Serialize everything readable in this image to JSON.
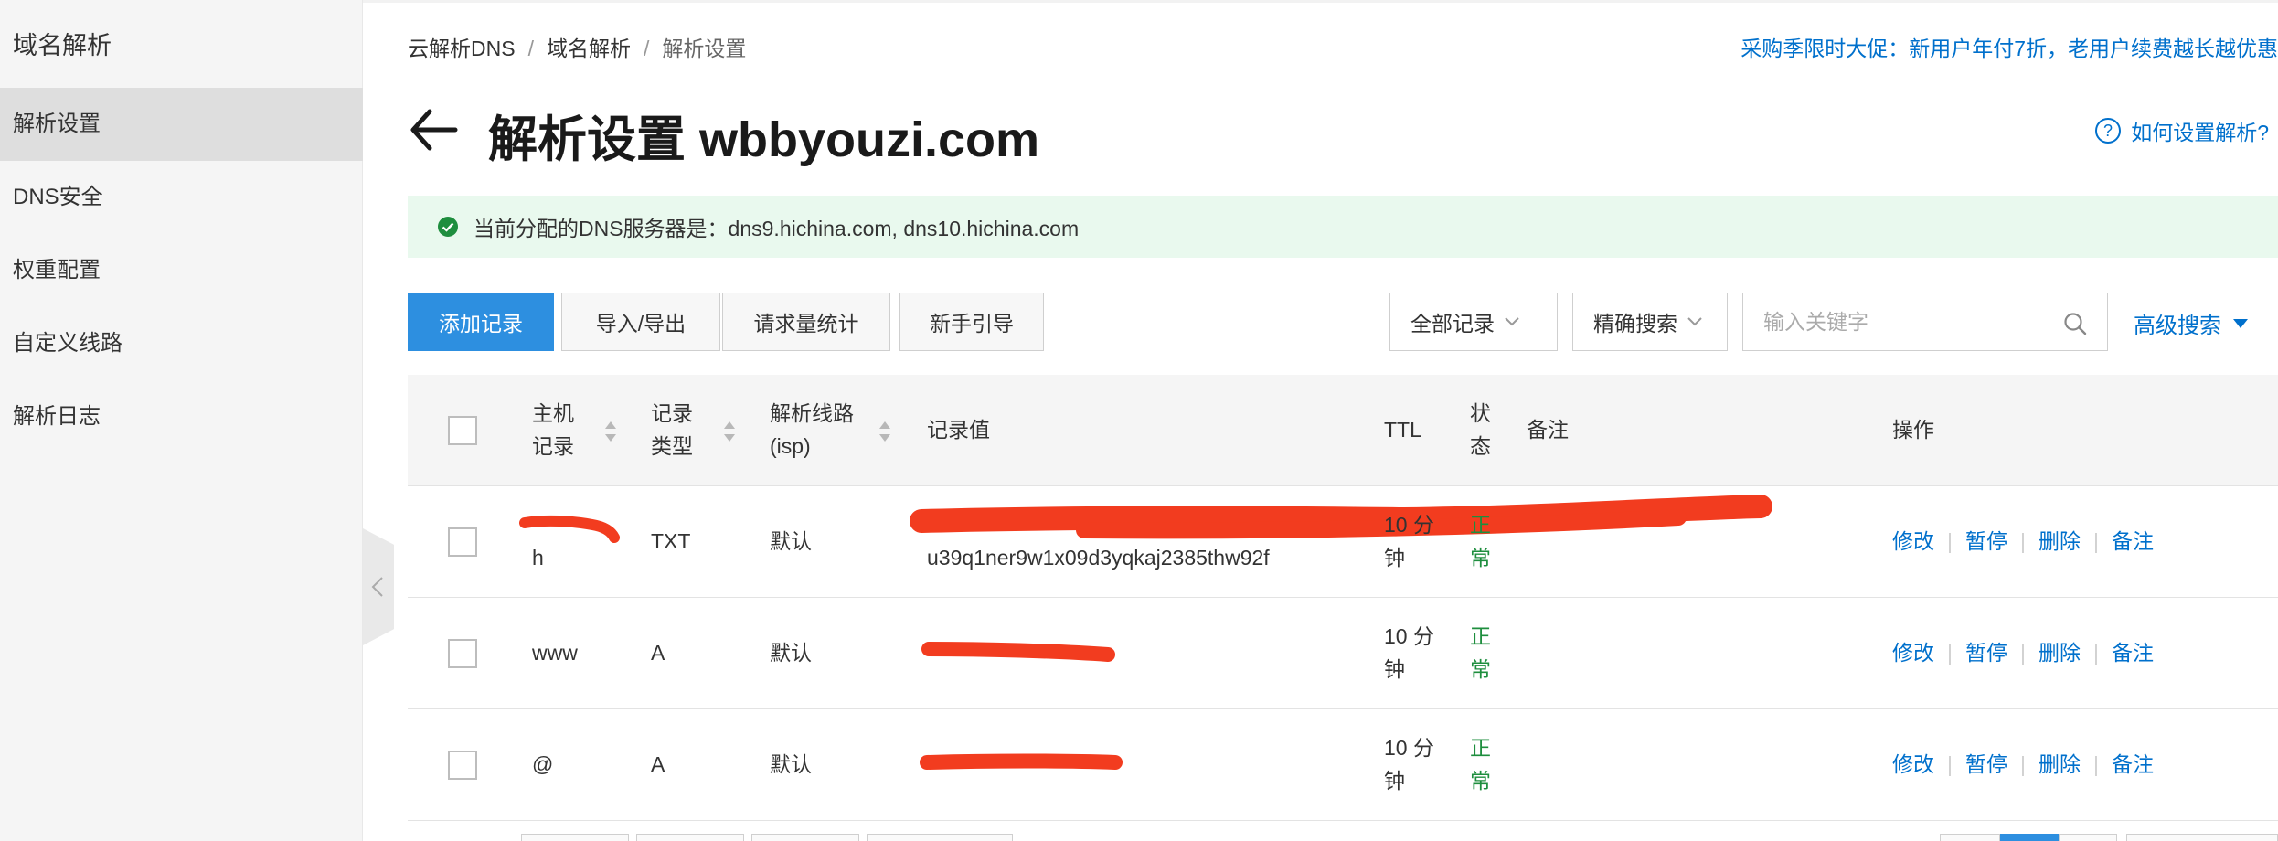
{
  "sidebar": {
    "title": "域名解析",
    "items": [
      {
        "label": "解析设置",
        "active": true
      },
      {
        "label": "DNS安全",
        "active": false
      },
      {
        "label": "权重配置",
        "active": false
      },
      {
        "label": "自定义线路",
        "active": false
      },
      {
        "label": "解析日志",
        "active": false
      }
    ]
  },
  "breadcrumb": [
    "云解析DNS",
    "域名解析",
    "解析设置"
  ],
  "promo": "采购季限时大促：新用户年付7折，老用户续费越长越优惠",
  "header": {
    "title": "解析设置 wbbyouzi.com",
    "help_link": "如何设置解析?"
  },
  "dns_banner": "当前分配的DNS服务器是：dns9.hichina.com, dns10.hichina.com",
  "toolbar": {
    "add_record": "添加记录",
    "import_export": "导入/导出",
    "request_stats": "请求量统计",
    "guide": "新手引导",
    "record_filter": "全部记录",
    "search_mode": "精确搜索",
    "search_placeholder": "输入关键字",
    "advanced_search": "高级搜索"
  },
  "table": {
    "columns": {
      "host": [
        "主机",
        "记录"
      ],
      "type": [
        "记录",
        "类型"
      ],
      "line": [
        "解析线路",
        "(isp)"
      ],
      "value": "记录值",
      "ttl": "TTL",
      "status": [
        "状",
        "态"
      ],
      "remark": "备注",
      "actions": "操作"
    },
    "rows": [
      {
        "host": [
          "",
          "h"
        ],
        "type": "TXT",
        "line": "默认",
        "value": [
          "",
          "u39q1ner9w1x09d3yqkaj2385thw92f"
        ],
        "ttl": [
          "10 分",
          "钟"
        ],
        "status": [
          "正",
          "常"
        ]
      },
      {
        "host": [
          "www"
        ],
        "type": "A",
        "line": "默认",
        "value": [
          ""
        ],
        "ttl": [
          "10 分",
          "钟"
        ],
        "status": [
          "正",
          "常"
        ]
      },
      {
        "host": [
          "@"
        ],
        "type": "A",
        "line": "默认",
        "value": [
          ""
        ],
        "ttl": [
          "10 分",
          "钟"
        ],
        "status": [
          "正",
          "常"
        ]
      }
    ],
    "actions": [
      "修改",
      "暂停",
      "删除",
      "备注"
    ]
  },
  "colors": {
    "accent": "#ff6a00",
    "primary": "#2d8fe0",
    "link": "#0070cc",
    "status_ok": "#1e8e3e",
    "redaction": "#f23c1f"
  }
}
